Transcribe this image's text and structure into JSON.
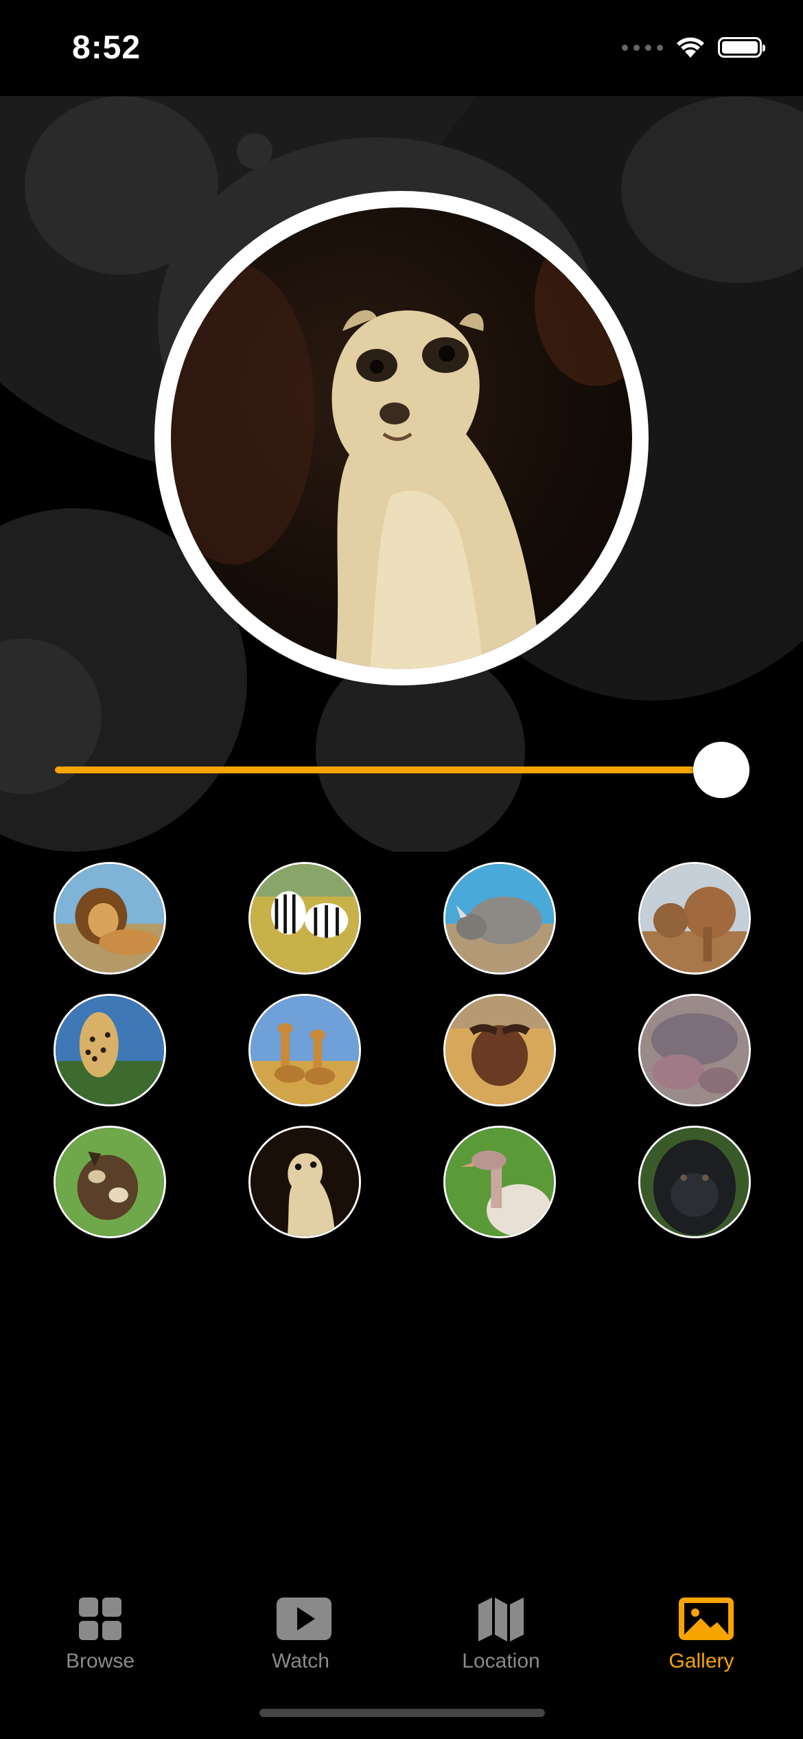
{
  "status_bar": {
    "time": "8:52",
    "icons": [
      "signal-dots-icon",
      "wifi-icon",
      "battery-icon"
    ]
  },
  "hero": {
    "animal": "meerkat",
    "ring_color": "#ffffff"
  },
  "slider": {
    "value_fraction": 0.96,
    "accent": "#f7a400"
  },
  "gallery": {
    "thumbnails": [
      {
        "animal": "lion"
      },
      {
        "animal": "zebra"
      },
      {
        "animal": "rhinoceros"
      },
      {
        "animal": "elephant"
      },
      {
        "animal": "cheetah"
      },
      {
        "animal": "giraffe"
      },
      {
        "animal": "buffalo"
      },
      {
        "animal": "hippopotamus"
      },
      {
        "animal": "wild-dog"
      },
      {
        "animal": "meerkat"
      },
      {
        "animal": "ostrich"
      },
      {
        "animal": "gorilla"
      }
    ]
  },
  "tabbar": {
    "accent": "#f7a400",
    "inactive": "#8a8a8a",
    "tabs": [
      {
        "label": "Browse",
        "icon": "grid-icon",
        "active": false
      },
      {
        "label": "Watch",
        "icon": "play-icon",
        "active": false
      },
      {
        "label": "Location",
        "icon": "map-icon",
        "active": false
      },
      {
        "label": "Gallery",
        "icon": "photo-icon",
        "active": true
      }
    ]
  }
}
